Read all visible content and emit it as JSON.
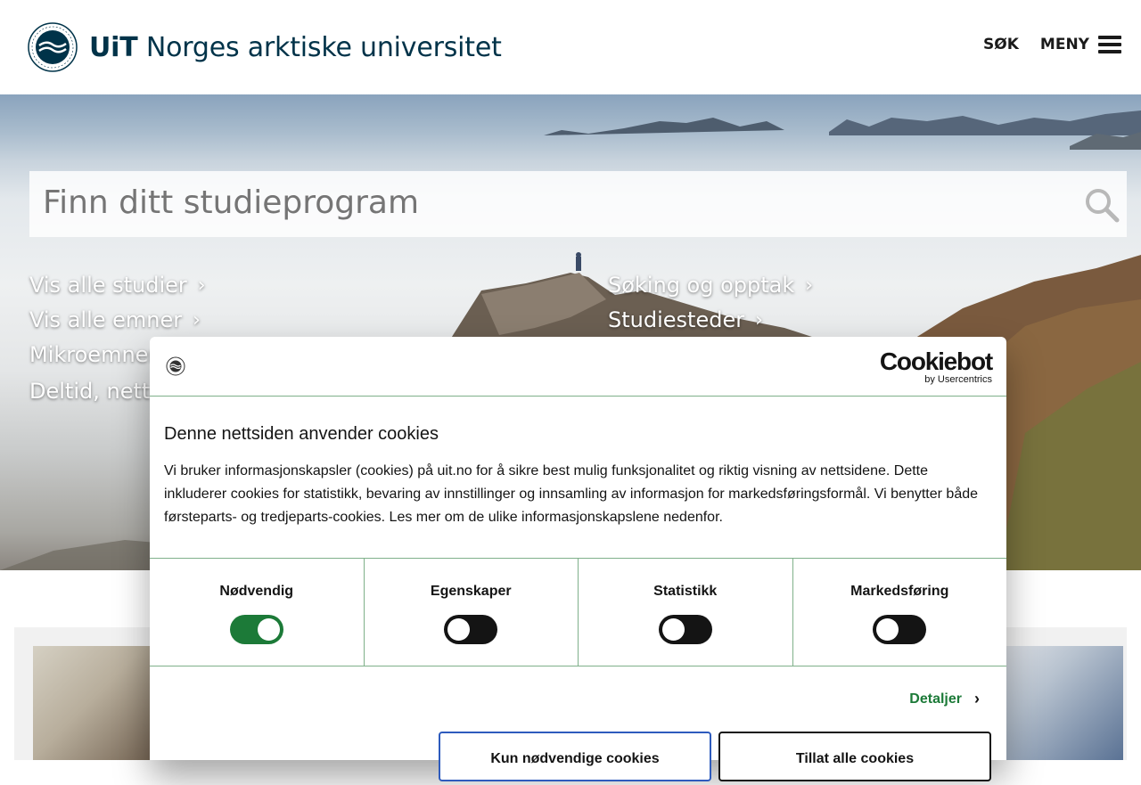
{
  "header": {
    "logo_bold": "UiT",
    "logo_rest": " Norges arktiske universitet",
    "search_label": "SØK",
    "menu_label": "MENY"
  },
  "hero": {
    "search_placeholder": "Finn ditt studieprogram",
    "links_left": [
      "Vis alle studier",
      "Vis alle emner",
      "Mikroemner",
      "Deltid, nett-"
    ],
    "links_right": [
      "Søking og opptak",
      "Studiesteder"
    ]
  },
  "cookie": {
    "brand_name": "Cookiebot",
    "brand_by": "by Usercentrics",
    "title": "Denne nettsiden anvender cookies",
    "body": "Vi bruker informasjonskapsler (cookies) på uit.no for å sikre best mulig funksjonalitet og riktig visning av nettsidene. Dette inkluderer cookies for statistikk, bevaring av innstillinger og innsamling av informasjon for markedsføringsformål. Vi benytter både førsteparts- og tredjeparts-cookies. Les mer om de ulike informasjonskapslene nedenfor.",
    "categories": [
      {
        "label": "Nødvendig",
        "enabled": true
      },
      {
        "label": "Egenskaper",
        "enabled": false
      },
      {
        "label": "Statistikk",
        "enabled": false
      },
      {
        "label": "Markedsføring",
        "enabled": false
      }
    ],
    "details_label": "Detaljer",
    "btn_necessary": "Kun nødvendige cookies",
    "btn_allow": "Tillat alle cookies",
    "accent_color": "#1c7a38"
  }
}
